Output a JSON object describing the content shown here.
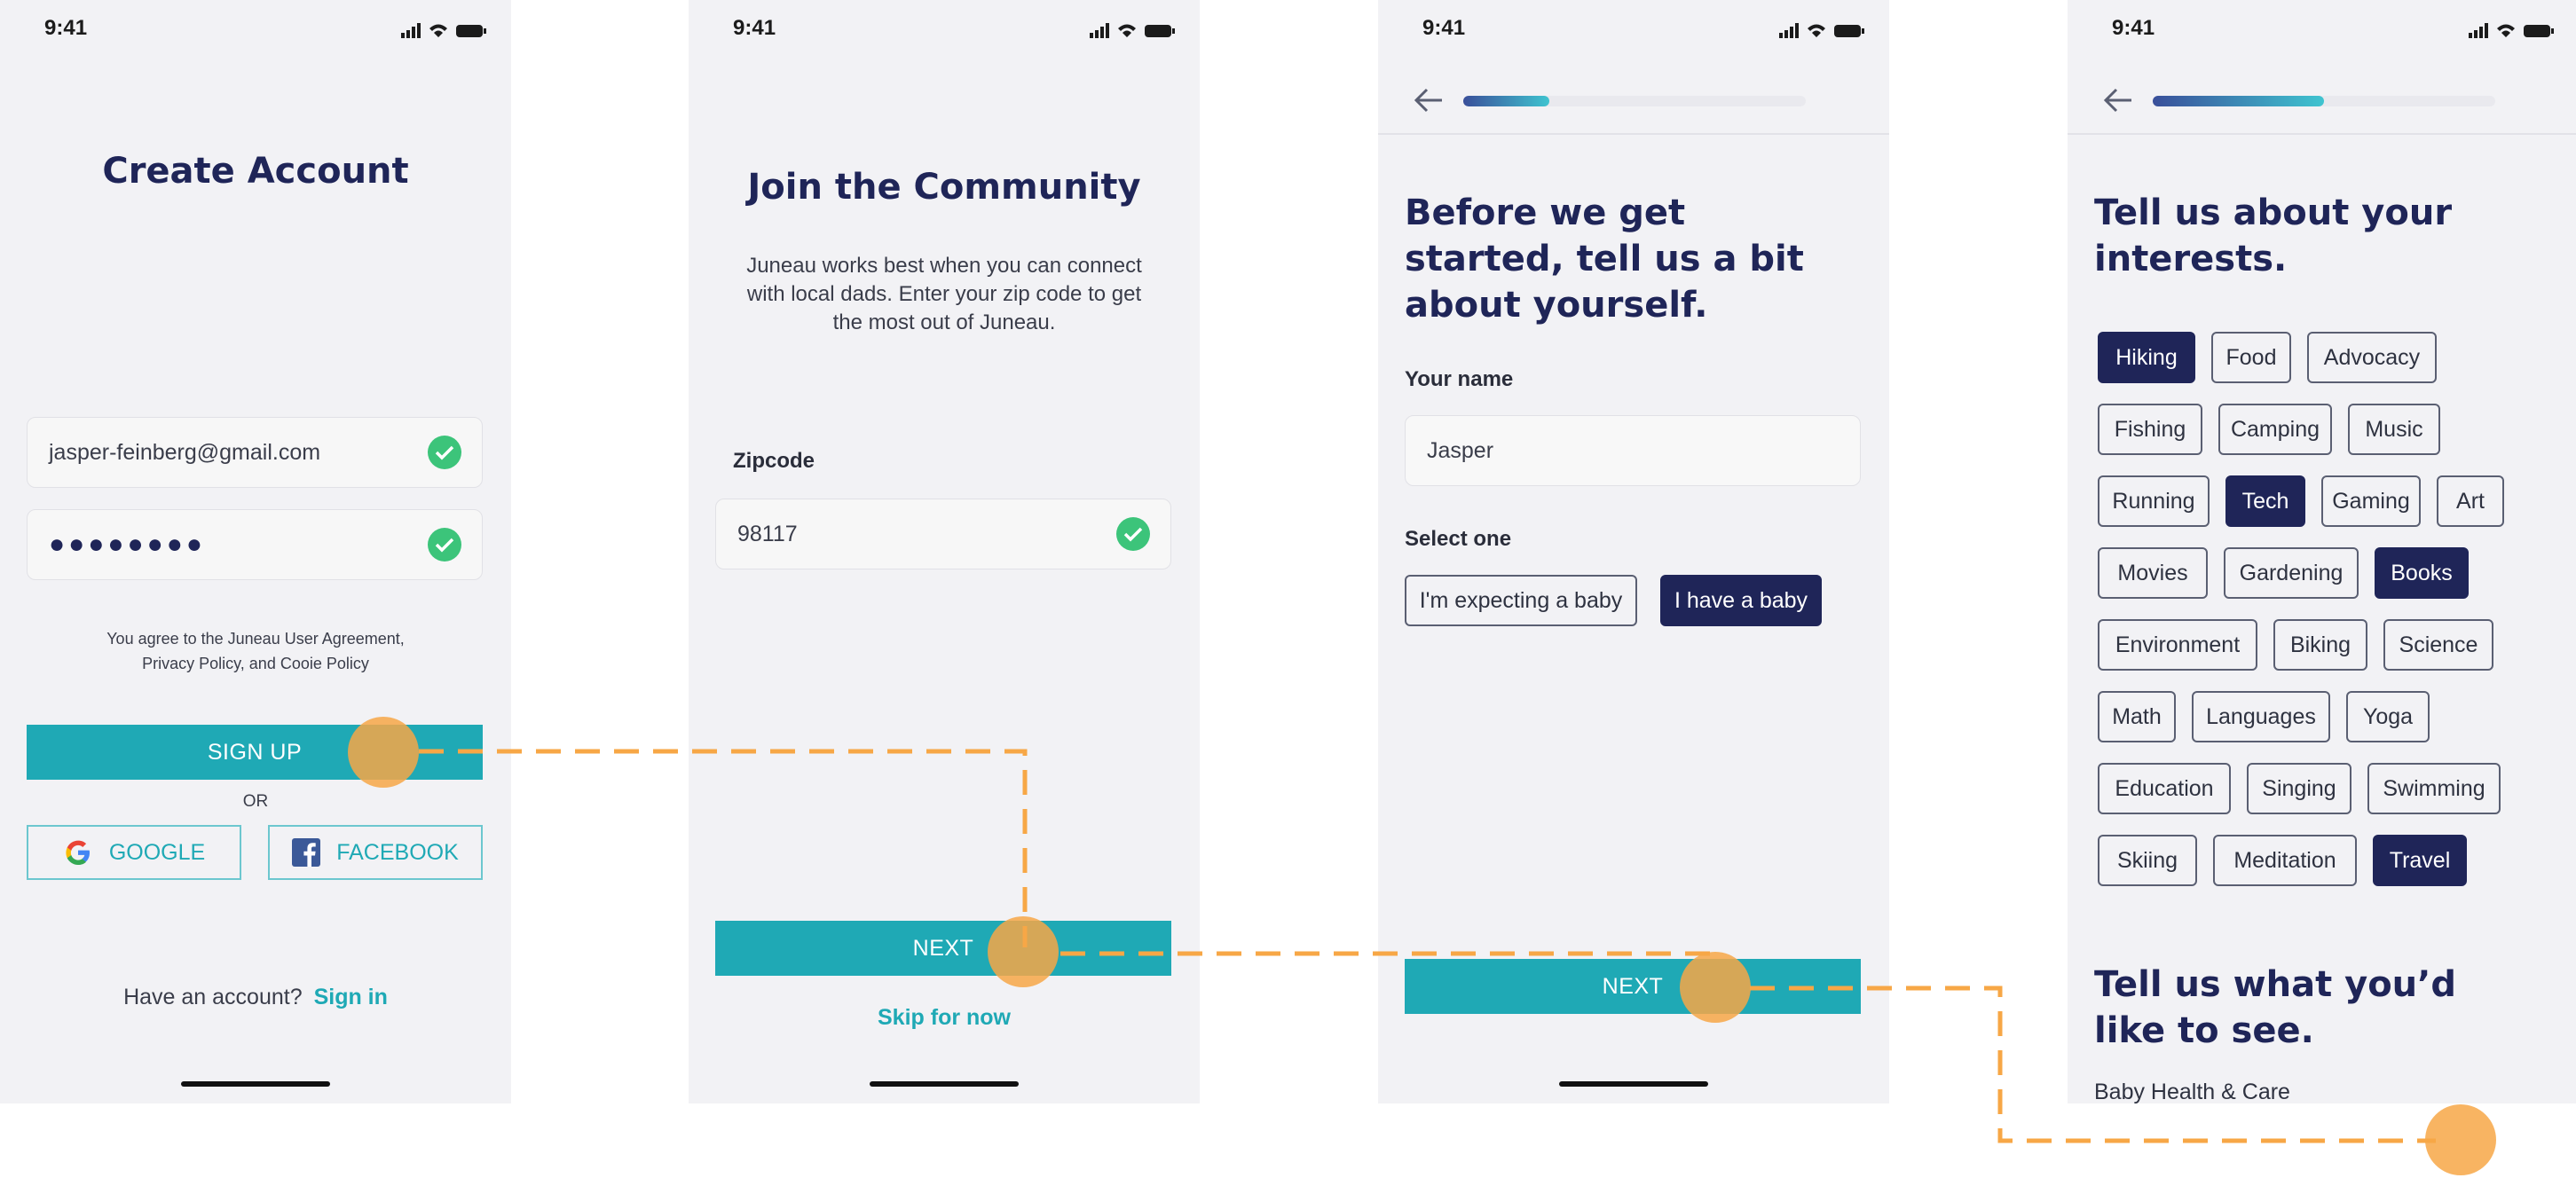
{
  "status_time": "9:41",
  "screen1": {
    "title": "Create Account",
    "email": "jasper-feinberg@gmail.com",
    "password_mask": "●●●●●●●●",
    "agreement_line1": "You agree to the Juneau User Agreement,",
    "agreement_line2": "Privacy Policy, and Cooie Policy",
    "signup_label": "SIGN UP",
    "or_label": "OR",
    "google_label": "GOOGLE",
    "facebook_label": "FACEBOOK",
    "have_account": "Have an account?",
    "sign_in": "Sign in"
  },
  "screen2": {
    "title": "Join the Community",
    "desc_line1": "Juneau works best when you can connect",
    "desc_line2": "with local dads. Enter your zip code to get",
    "desc_line3": "the most out of Juneau.",
    "zip_label": "Zipcode",
    "zip_value": "98117",
    "next_label": "NEXT",
    "skip_label": "Skip for now"
  },
  "screen3": {
    "progress": 0.25,
    "title_line1": "Before we get",
    "title_line2": "started, tell us a bit",
    "title_line3": "about yourself.",
    "name_label": "Your name",
    "name_value": "Jasper",
    "select_label": "Select one",
    "option_expecting": "I'm expecting a baby",
    "option_have": "I have a baby",
    "selected_option": "I have a baby",
    "next_label": "NEXT"
  },
  "screen4": {
    "progress": 0.5,
    "title_line1": "Tell us about your",
    "title_line2": "interests.",
    "interests": [
      {
        "label": "Hiking",
        "selected": true
      },
      {
        "label": "Food",
        "selected": false
      },
      {
        "label": "Advocacy",
        "selected": false
      },
      {
        "label": "Fishing",
        "selected": false
      },
      {
        "label": "Camping",
        "selected": false
      },
      {
        "label": "Music",
        "selected": false
      },
      {
        "label": "Running",
        "selected": false
      },
      {
        "label": "Tech",
        "selected": true
      },
      {
        "label": "Gaming",
        "selected": false
      },
      {
        "label": "Art",
        "selected": false
      },
      {
        "label": "Movies",
        "selected": false
      },
      {
        "label": "Gardening",
        "selected": false
      },
      {
        "label": "Books",
        "selected": true
      },
      {
        "label": "Environment",
        "selected": false
      },
      {
        "label": "Biking",
        "selected": false
      },
      {
        "label": "Science",
        "selected": false
      },
      {
        "label": "Math",
        "selected": false
      },
      {
        "label": "Languages",
        "selected": false
      },
      {
        "label": "Yoga",
        "selected": false
      },
      {
        "label": "Education",
        "selected": false
      },
      {
        "label": "Singing",
        "selected": false
      },
      {
        "label": "Swimming",
        "selected": false
      },
      {
        "label": "Skiing",
        "selected": false
      },
      {
        "label": "Meditation",
        "selected": false
      },
      {
        "label": "Travel",
        "selected": true
      }
    ],
    "see_title_line1": "Tell us what you’d",
    "see_title_line2": "like to see.",
    "see_item": "Baby Health & Care"
  },
  "colors": {
    "teal": "#1fa9b5",
    "navy": "#1f2558",
    "check_green": "#3cc47a",
    "flow_orange": "#f7a746",
    "screen_bg": "#f2f2f5"
  }
}
